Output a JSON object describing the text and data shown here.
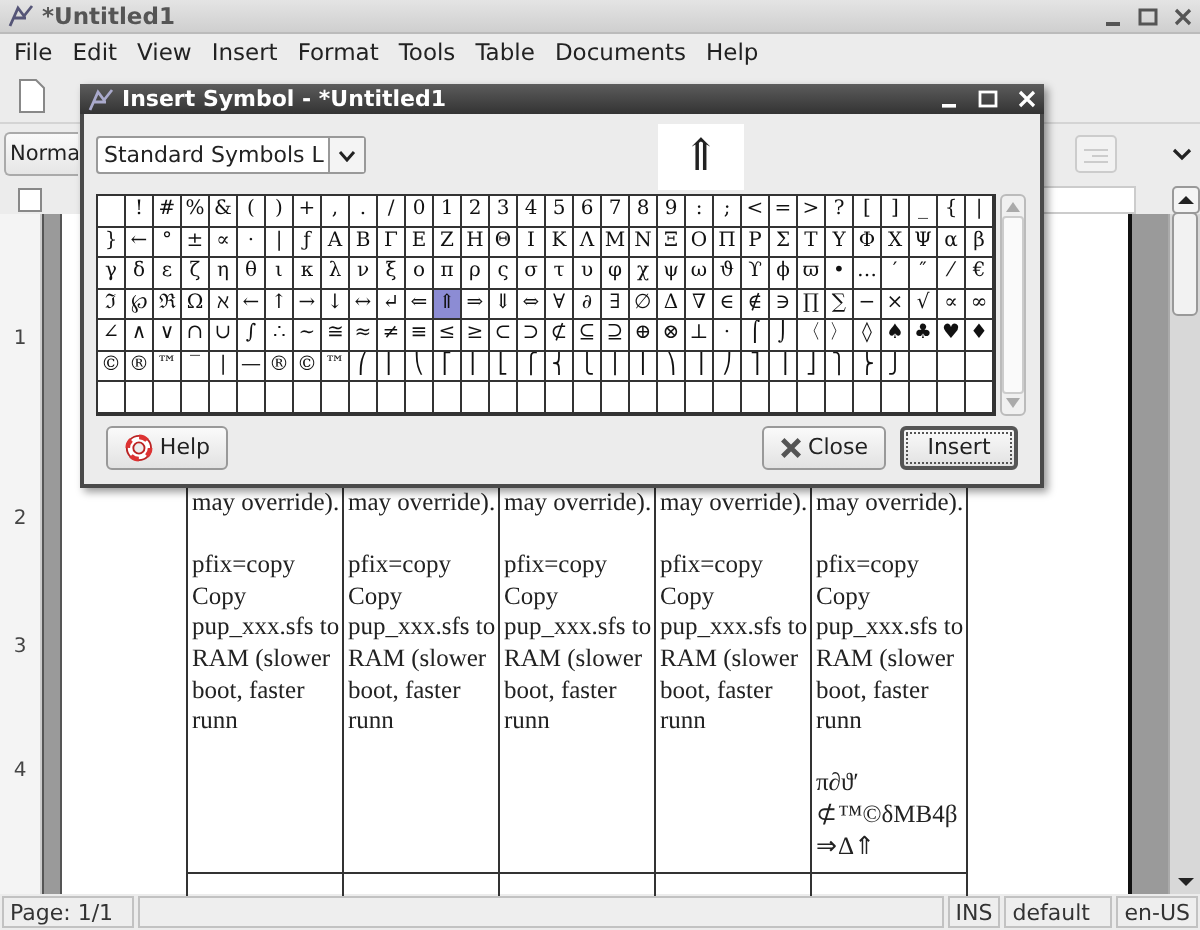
{
  "window": {
    "title": "*Untitled1"
  },
  "menu": [
    {
      "label": "File"
    },
    {
      "label": "Edit"
    },
    {
      "label": "View"
    },
    {
      "label": "Insert"
    },
    {
      "label": "Format"
    },
    {
      "label": "Tools"
    },
    {
      "label": "Table"
    },
    {
      "label": "Documents"
    },
    {
      "label": "Help"
    }
  ],
  "formatting_bar": {
    "style_box": "Norma"
  },
  "vertical_ruler": [
    "1",
    "2",
    "3",
    "4"
  ],
  "document": {
    "table_columns": [
      {
        "paragraphs": [
          [
            "may override)."
          ],
          [
            "pfix=copy",
            "Copy",
            "pup_xxx.sfs to",
            "RAM (slower",
            "boot, faster",
            "runn"
          ]
        ]
      },
      {
        "paragraphs": [
          [
            "may override)."
          ],
          [
            "pfix=copy",
            "Copy",
            "pup_xxx.sfs to",
            "RAM (slower",
            "boot, faster",
            "runn"
          ]
        ]
      },
      {
        "paragraphs": [
          [
            "may override)."
          ],
          [
            "pfix=copy",
            "Copy",
            "pup_xxx.sfs to",
            "RAM (slower",
            "boot, faster",
            "runn"
          ]
        ]
      },
      {
        "paragraphs": [
          [
            "may override)."
          ],
          [
            "pfix=copy",
            "Copy",
            "pup_xxx.sfs to",
            "RAM (slower",
            "boot, faster",
            "runn"
          ]
        ]
      },
      {
        "paragraphs": [
          [
            "may override)."
          ],
          [
            "pfix=copy",
            "Copy",
            "pup_xxx.sfs to",
            "RAM (slower",
            "boot, faster",
            "runn"
          ],
          [
            "π∂ϑ′",
            "⊄™©δMB4β",
            "⇒Δ⇑"
          ]
        ]
      }
    ]
  },
  "dialog": {
    "title": "Insert Symbol - *Untitled1",
    "font": "Standard Symbols L",
    "preview": "⇑",
    "symbol_rows": [
      [
        {
          "selected": false
        },
        {
          "symbol": "!",
          "selected": false
        },
        {
          "symbol": "#",
          "selected": false
        },
        {
          "symbol": "%",
          "selected": false
        },
        {
          "symbol": "&",
          "selected": false
        },
        {
          "symbol": "(",
          "selected": false
        },
        {
          "symbol": ")",
          "selected": false
        },
        {
          "symbol": "+",
          "selected": false
        },
        {
          "symbol": ",",
          "selected": false
        },
        {
          "symbol": ".",
          "selected": false
        },
        {
          "symbol": "/",
          "selected": false
        },
        {
          "symbol": "0",
          "selected": false
        },
        {
          "symbol": "1",
          "selected": false
        },
        {
          "symbol": "2",
          "selected": false
        },
        {
          "symbol": "3",
          "selected": false
        },
        {
          "symbol": "4",
          "selected": false
        },
        {
          "symbol": "5",
          "selected": false
        },
        {
          "symbol": "6",
          "selected": false
        },
        {
          "symbol": "7",
          "selected": false
        },
        {
          "symbol": "8",
          "selected": false
        },
        {
          "symbol": "9",
          "selected": false
        },
        {
          "symbol": ":",
          "selected": false
        },
        {
          "symbol": ";",
          "selected": false
        },
        {
          "symbol": "<",
          "selected": false
        },
        {
          "symbol": "=",
          "selected": false
        },
        {
          "symbol": ">",
          "selected": false
        },
        {
          "symbol": "?",
          "selected": false
        },
        {
          "symbol": "[",
          "selected": false
        },
        {
          "symbol": "]",
          "selected": false
        },
        {
          "symbol": "_",
          "selected": false
        },
        {
          "symbol": "{",
          "selected": false
        },
        {
          "symbol": "|",
          "selected": false
        }
      ],
      [
        {
          "symbol": "}",
          "selected": false
        },
        {
          "symbol": "←",
          "selected": false
        },
        {
          "symbol": "°",
          "selected": false
        },
        {
          "symbol": "±",
          "selected": false
        },
        {
          "symbol": "∝",
          "selected": false
        },
        {
          "symbol": "·",
          "selected": false
        },
        {
          "symbol": "|",
          "selected": false
        },
        {
          "symbol": "ƒ",
          "selected": false
        },
        {
          "symbol": "Α",
          "selected": false
        },
        {
          "symbol": "Β",
          "selected": false
        },
        {
          "symbol": "Γ",
          "selected": false
        },
        {
          "symbol": "Ε",
          "selected": false
        },
        {
          "symbol": "Ζ",
          "selected": false
        },
        {
          "symbol": "Η",
          "selected": false
        },
        {
          "symbol": "Θ",
          "selected": false
        },
        {
          "symbol": "Ι",
          "selected": false
        },
        {
          "symbol": "Κ",
          "selected": false
        },
        {
          "symbol": "Λ",
          "selected": false
        },
        {
          "symbol": "Μ",
          "selected": false
        },
        {
          "symbol": "Ν",
          "selected": false
        },
        {
          "symbol": "Ξ",
          "selected": false
        },
        {
          "symbol": "Ο",
          "selected": false
        },
        {
          "symbol": "Π",
          "selected": false
        },
        {
          "symbol": "Ρ",
          "selected": false
        },
        {
          "symbol": "Σ",
          "selected": false
        },
        {
          "symbol": "Τ",
          "selected": false
        },
        {
          "symbol": "Υ",
          "selected": false
        },
        {
          "symbol": "Φ",
          "selected": false
        },
        {
          "symbol": "Χ",
          "selected": false
        },
        {
          "symbol": "Ψ",
          "selected": false
        },
        {
          "symbol": "α",
          "selected": false
        },
        {
          "symbol": "β",
          "selected": false
        }
      ],
      [
        {
          "symbol": "γ",
          "selected": false
        },
        {
          "symbol": "δ",
          "selected": false
        },
        {
          "symbol": "ε",
          "selected": false
        },
        {
          "symbol": "ζ",
          "selected": false
        },
        {
          "symbol": "η",
          "selected": false
        },
        {
          "symbol": "θ",
          "selected": false
        },
        {
          "symbol": "ι",
          "selected": false
        },
        {
          "symbol": "κ",
          "selected": false
        },
        {
          "symbol": "λ",
          "selected": false
        },
        {
          "symbol": "ν",
          "selected": false
        },
        {
          "symbol": "ξ",
          "selected": false
        },
        {
          "symbol": "ο",
          "selected": false
        },
        {
          "symbol": "π",
          "selected": false
        },
        {
          "symbol": "ρ",
          "selected": false
        },
        {
          "symbol": "ς",
          "selected": false
        },
        {
          "symbol": "σ",
          "selected": false
        },
        {
          "symbol": "τ",
          "selected": false
        },
        {
          "symbol": "υ",
          "selected": false
        },
        {
          "symbol": "φ",
          "selected": false
        },
        {
          "symbol": "χ",
          "selected": false
        },
        {
          "symbol": "ψ",
          "selected": false
        },
        {
          "symbol": "ω",
          "selected": false
        },
        {
          "symbol": "ϑ",
          "selected": false
        },
        {
          "symbol": "ϒ",
          "selected": false
        },
        {
          "symbol": "ϕ",
          "selected": false
        },
        {
          "symbol": "ϖ",
          "selected": false
        },
        {
          "symbol": "•",
          "selected": false
        },
        {
          "symbol": "…",
          "selected": false
        },
        {
          "symbol": "′",
          "selected": false
        },
        {
          "symbol": "″",
          "selected": false
        },
        {
          "symbol": "⁄",
          "selected": false
        },
        {
          "symbol": "€",
          "selected": false
        }
      ],
      [
        {
          "symbol": "ℑ",
          "selected": false
        },
        {
          "symbol": "℘",
          "selected": false
        },
        {
          "symbol": "ℜ",
          "selected": false
        },
        {
          "symbol": "Ω",
          "selected": false
        },
        {
          "symbol": "ℵ",
          "selected": false
        },
        {
          "symbol": "←",
          "selected": false
        },
        {
          "symbol": "↑",
          "selected": false
        },
        {
          "symbol": "→",
          "selected": false
        },
        {
          "symbol": "↓",
          "selected": false
        },
        {
          "symbol": "↔",
          "selected": false
        },
        {
          "symbol": "↵",
          "selected": false
        },
        {
          "symbol": "⇐",
          "selected": false
        },
        {
          "symbol": "⇑",
          "selected": true
        },
        {
          "symbol": "⇒",
          "selected": false
        },
        {
          "symbol": "⇓",
          "selected": false
        },
        {
          "symbol": "⇔",
          "selected": false
        },
        {
          "symbol": "∀",
          "selected": false
        },
        {
          "symbol": "∂",
          "selected": false
        },
        {
          "symbol": "∃",
          "selected": false
        },
        {
          "symbol": "∅",
          "selected": false
        },
        {
          "symbol": "Δ",
          "selected": false
        },
        {
          "symbol": "∇",
          "selected": false
        },
        {
          "symbol": "∈",
          "selected": false
        },
        {
          "symbol": "∉",
          "selected": false
        },
        {
          "symbol": "∋",
          "selected": false
        },
        {
          "symbol": "∏",
          "selected": false
        },
        {
          "symbol": "∑",
          "selected": false
        },
        {
          "symbol": "−",
          "selected": false
        },
        {
          "symbol": "×",
          "selected": false
        },
        {
          "symbol": "√",
          "selected": false
        },
        {
          "symbol": "∝",
          "selected": false
        },
        {
          "symbol": "∞",
          "selected": false
        }
      ],
      [
        {
          "symbol": "∠",
          "selected": false
        },
        {
          "symbol": "∧",
          "selected": false
        },
        {
          "symbol": "∨",
          "selected": false
        },
        {
          "symbol": "∩",
          "selected": false
        },
        {
          "symbol": "∪",
          "selected": false
        },
        {
          "symbol": "∫",
          "selected": false
        },
        {
          "symbol": "∴",
          "selected": false
        },
        {
          "symbol": "∼",
          "selected": false
        },
        {
          "symbol": "≅",
          "selected": false
        },
        {
          "symbol": "≈",
          "selected": false
        },
        {
          "symbol": "≠",
          "selected": false
        },
        {
          "symbol": "≡",
          "selected": false
        },
        {
          "symbol": "≤",
          "selected": false
        },
        {
          "symbol": "≥",
          "selected": false
        },
        {
          "symbol": "⊂",
          "selected": false
        },
        {
          "symbol": "⊃",
          "selected": false
        },
        {
          "symbol": "⊄",
          "selected": false
        },
        {
          "symbol": "⊆",
          "selected": false
        },
        {
          "symbol": "⊇",
          "selected": false
        },
        {
          "symbol": "⊕",
          "selected": false
        },
        {
          "symbol": "⊗",
          "selected": false
        },
        {
          "symbol": "⊥",
          "selected": false
        },
        {
          "symbol": "⋅",
          "selected": false
        },
        {
          "symbol": "⌠",
          "selected": false
        },
        {
          "symbol": "⌡",
          "selected": false
        },
        {
          "symbol": "〈",
          "selected": false
        },
        {
          "symbol": "〉",
          "selected": false
        },
        {
          "symbol": "◊",
          "selected": false
        },
        {
          "symbol": "♠",
          "selected": false
        },
        {
          "symbol": "♣",
          "selected": false
        },
        {
          "symbol": "♥",
          "selected": false
        },
        {
          "symbol": "♦",
          "selected": false
        }
      ],
      [
        {
          "symbol": "©",
          "selected": false
        },
        {
          "symbol": "®",
          "selected": false
        },
        {
          "symbol": "™",
          "selected": false
        },
        {
          "symbol": "‾",
          "selected": false
        },
        {
          "symbol": "|",
          "selected": false
        },
        {
          "symbol": "—",
          "selected": false
        },
        {
          "symbol": "®",
          "selected": false
        },
        {
          "symbol": "©",
          "selected": false
        },
        {
          "symbol": "™",
          "selected": false
        },
        {
          "symbol": "⎛",
          "selected": false
        },
        {
          "symbol": "⎜",
          "selected": false
        },
        {
          "symbol": "⎝",
          "selected": false
        },
        {
          "symbol": "⎡",
          "selected": false
        },
        {
          "symbol": "⎢",
          "selected": false
        },
        {
          "symbol": "⎣",
          "selected": false
        },
        {
          "symbol": "⎧",
          "selected": false
        },
        {
          "symbol": "⎨",
          "selected": false
        },
        {
          "symbol": "⎩",
          "selected": false
        },
        {
          "symbol": "⎪",
          "selected": false
        },
        {
          "symbol": "⎮",
          "selected": false
        },
        {
          "symbol": "⎞",
          "selected": false
        },
        {
          "symbol": "⎟",
          "selected": false
        },
        {
          "symbol": "⎠",
          "selected": false
        },
        {
          "symbol": "⎤",
          "selected": false
        },
        {
          "symbol": "⎥",
          "selected": false
        },
        {
          "symbol": "⎦",
          "selected": false
        },
        {
          "symbol": "⎫",
          "selected": false
        },
        {
          "symbol": "⎬",
          "selected": false
        },
        {
          "symbol": "⎭",
          "selected": false
        },
        {
          "selected": false
        },
        {
          "selected": false
        },
        {
          "selected": false
        }
      ],
      [
        {
          "selected": false
        },
        {
          "selected": false
        },
        {
          "selected": false
        },
        {
          "selected": false
        },
        {
          "selected": false
        },
        {
          "selected": false
        },
        {
          "selected": false
        },
        {
          "selected": false
        },
        {
          "selected": false
        },
        {
          "selected": false
        },
        {
          "selected": false
        },
        {
          "selected": false
        },
        {
          "selected": false
        },
        {
          "selected": false
        },
        {
          "selected": false
        },
        {
          "selected": false
        },
        {
          "selected": false
        },
        {
          "selected": false
        },
        {
          "selected": false
        },
        {
          "selected": false
        },
        {
          "selected": false
        },
        {
          "selected": false
        },
        {
          "selected": false
        },
        {
          "selected": false
        },
        {
          "selected": false
        },
        {
          "selected": false
        },
        {
          "selected": false
        },
        {
          "selected": false
        },
        {
          "selected": false
        },
        {
          "selected": false
        },
        {
          "selected": false
        },
        {
          "selected": false
        }
      ]
    ],
    "buttons": [
      {
        "kind": "help",
        "label": "Help"
      },
      {
        "kind": "close",
        "label": "Close"
      },
      {
        "kind": "insert",
        "label": "Insert"
      }
    ]
  },
  "status_bar": {
    "page": "Page: 1/1",
    "mode": "INS",
    "page_style": "default",
    "language": "en-US"
  }
}
